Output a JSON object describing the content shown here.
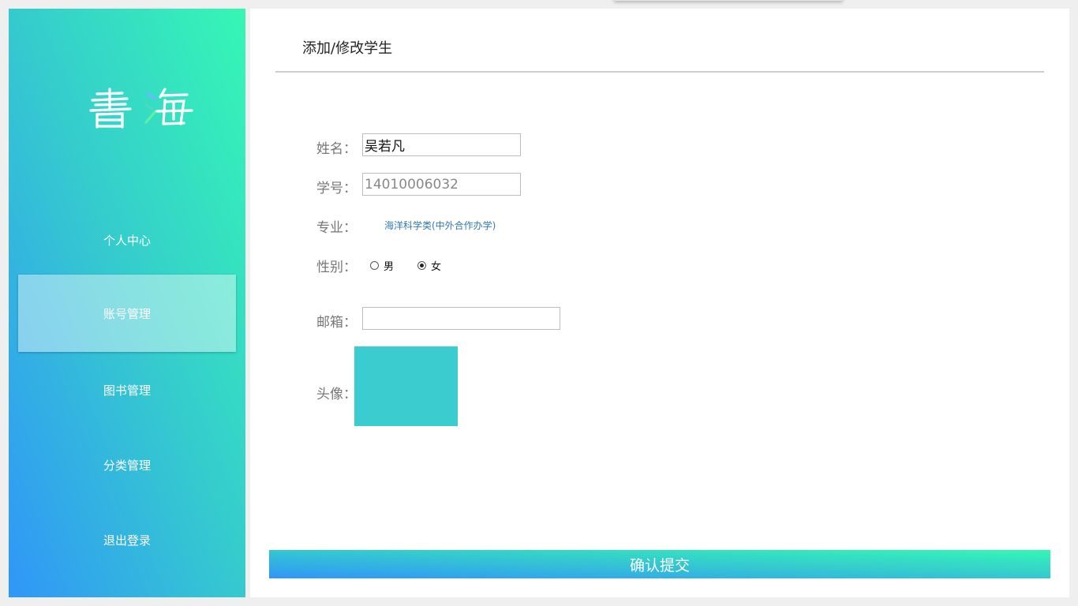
{
  "app": {
    "logo_text": "書海"
  },
  "sidebar": {
    "items": [
      {
        "label": "个人中心",
        "active": false
      },
      {
        "label": "账号管理",
        "active": true
      },
      {
        "label": "图书管理",
        "active": false
      },
      {
        "label": "分类管理",
        "active": false
      },
      {
        "label": "退出登录",
        "active": false
      }
    ]
  },
  "form": {
    "title": "添加/修改学生",
    "name_label": "姓名：",
    "name_value": "吴若凡",
    "student_id_label": "学号：",
    "student_id_value": "14010006032",
    "major_label": "专业：",
    "major_value": "海洋科学类(中外合作办学)",
    "gender_label": "性别：",
    "gender_options": [
      {
        "label": "男",
        "checked": false
      },
      {
        "label": "女",
        "checked": true
      }
    ],
    "email_label": "邮箱：",
    "email_value": "",
    "avatar_label": "头像：",
    "submit_label": "确认提交"
  },
  "colors": {
    "gradient_blue": "#3096f8",
    "gradient_teal": "#35cccd",
    "gradient_green": "#35f7b4",
    "avatar_color": "#3accce",
    "major_link": "#337ab7"
  }
}
